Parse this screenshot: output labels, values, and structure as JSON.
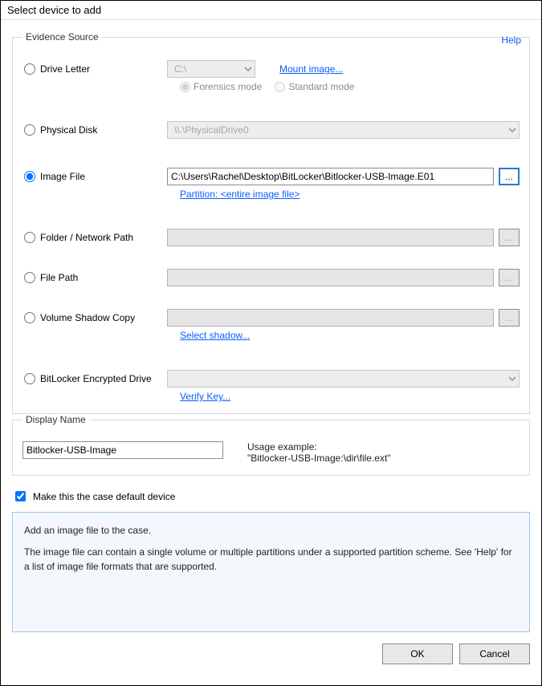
{
  "window_title": "Select device to add",
  "group_evidence": {
    "legend": "Evidence Source",
    "help": "Help",
    "drive_letter": {
      "label": "Drive Letter",
      "selected": "C:\\",
      "mount_link": "Mount image...",
      "forensics_label": "Forensics mode",
      "standard_label": "Standard mode"
    },
    "physical_disk": {
      "label": "Physical Disk",
      "selected": "\\\\.\\PhysicalDrive0"
    },
    "image_file": {
      "label": "Image File",
      "path": "C:\\Users\\Rachel\\Desktop\\BitLocker\\Bitlocker-USB-Image.E01",
      "browse": "...",
      "partition_link": "Partition: <entire image file>"
    },
    "folder_path": {
      "label": "Folder / Network Path",
      "browse": "..."
    },
    "file_path": {
      "label": "File Path",
      "browse": "..."
    },
    "vsc": {
      "label": "Volume Shadow Copy",
      "browse": "...",
      "select_link": "Select shadow..."
    },
    "bitlocker": {
      "label": "BitLocker Encrypted Drive",
      "verify_link": "Verify Key..."
    }
  },
  "display_name": {
    "legend": "Display Name",
    "value": "Bitlocker-USB-Image",
    "usage_label": "Usage example:",
    "usage_value": "\"Bitlocker-USB-Image:\\dir\\file.ext\""
  },
  "make_default_label": "Make this the case default device",
  "info_panel": {
    "line1": "Add an image file to the case.",
    "line2": "The image file can contain a single volume or multiple partitions under a supported partition scheme. See 'Help' for a list of image file formats that are supported."
  },
  "buttons": {
    "ok": "OK",
    "cancel": "Cancel"
  }
}
